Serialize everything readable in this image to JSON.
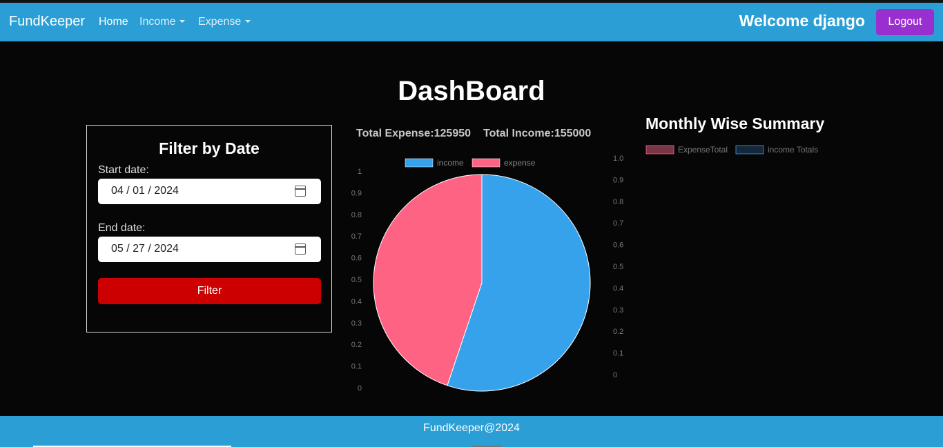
{
  "navbar": {
    "brand": "FundKeeper",
    "home": "Home",
    "income": "Income",
    "expense": "Expense",
    "welcome": "Welcome django",
    "logout": "Logout"
  },
  "page_title": "DashBoard",
  "filter": {
    "title": "Filter by Date",
    "start_label": "Start date:",
    "start_value": "04 / 01 / 2024",
    "end_label": "End date:",
    "end_value": "05 / 27 / 2024",
    "button": "Filter"
  },
  "totals": {
    "expense": "Total Expense:125950",
    "income": "Total Income:155000"
  },
  "summary": {
    "title": "Monthly Wise Summary",
    "legend": [
      "ExpenseTotal",
      "income Totals"
    ]
  },
  "colors": {
    "navbar": "#2b9fd5",
    "income": "#36a2eb",
    "expense": "#ff6384",
    "filter_button": "#cc0000",
    "logout_button": "#9a2fd0"
  },
  "footer": "FundKeeper@2024",
  "chart_data": [
    {
      "type": "pie",
      "categories": [
        "income",
        "expense"
      ],
      "values": [
        155000,
        125950
      ],
      "colors": [
        "#36a2eb",
        "#ff6384"
      ],
      "legend": [
        "income",
        "expense"
      ],
      "legend_position": "top",
      "y_ticks_left": [
        "0",
        "0.1",
        "0.2",
        "0.3",
        "0.4",
        "0.5",
        "0.6",
        "0.7",
        "0.8",
        "0.9",
        "1"
      ],
      "y_ticks_right": [
        "0",
        "0.1",
        "0.2",
        "0.3",
        "0.4",
        "0.5",
        "0.6",
        "0.7",
        "0.8",
        "0.9",
        "1.0"
      ]
    },
    {
      "type": "bar",
      "title": "Monthly Wise Summary",
      "series": [
        {
          "name": "ExpenseTotal",
          "values": []
        },
        {
          "name": "income Totals",
          "values": []
        }
      ],
      "legend_position": "top"
    }
  ]
}
